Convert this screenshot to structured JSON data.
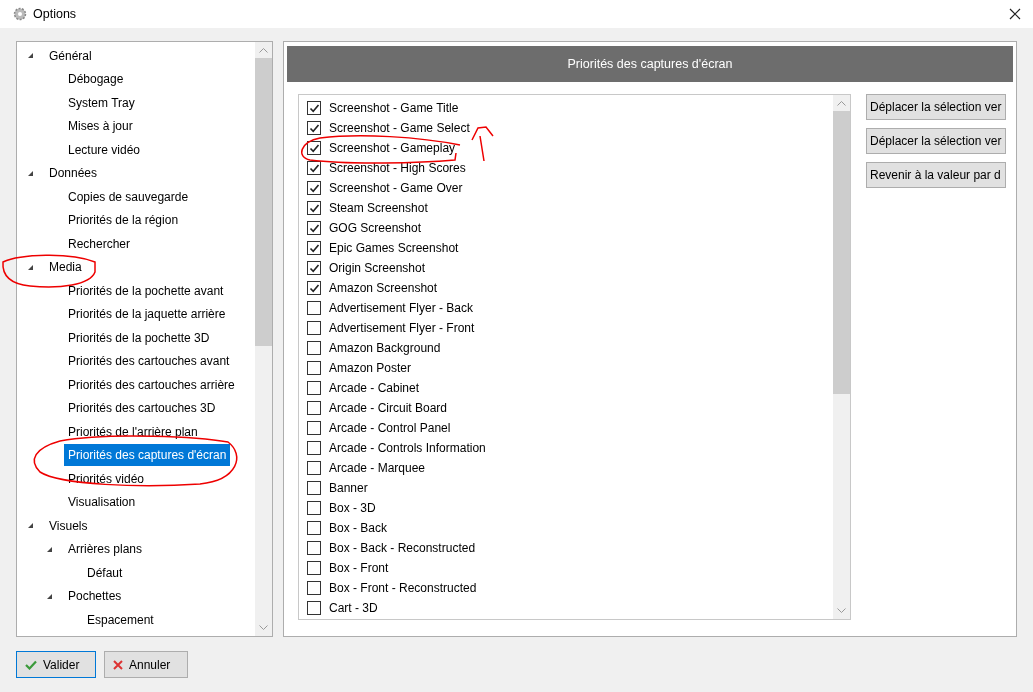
{
  "window": {
    "title": "Options"
  },
  "tree": [
    {
      "label": "Général",
      "expanded": true,
      "selected": false,
      "children": [
        {
          "label": "Débogage",
          "selected": false
        },
        {
          "label": "System Tray",
          "selected": false
        },
        {
          "label": "Mises à jour",
          "selected": false
        },
        {
          "label": "Lecture vidéo",
          "selected": false
        }
      ]
    },
    {
      "label": "Données",
      "expanded": true,
      "selected": false,
      "children": [
        {
          "label": "Copies de sauvegarde",
          "selected": false
        },
        {
          "label": "Priorités de la région",
          "selected": false
        },
        {
          "label": "Rechercher",
          "selected": false
        }
      ]
    },
    {
      "label": "Media",
      "expanded": true,
      "selected": false,
      "children": [
        {
          "label": "Priorités de la pochette avant",
          "selected": false
        },
        {
          "label": "Priorités de la jaquette arrière",
          "selected": false
        },
        {
          "label": "Priorités de la pochette 3D",
          "selected": false
        },
        {
          "label": "Priorités des cartouches avant",
          "selected": false
        },
        {
          "label": "Priorités des cartouches arrière",
          "selected": false
        },
        {
          "label": "Priorités des cartouches 3D",
          "selected": false
        },
        {
          "label": "Priorités de l'arrière plan",
          "selected": false
        },
        {
          "label": "Priorités des captures d'écran",
          "selected": true
        },
        {
          "label": "Priorités vidéo",
          "selected": false
        },
        {
          "label": "Visualisation",
          "selected": false
        }
      ]
    },
    {
      "label": "Visuels",
      "expanded": true,
      "selected": false,
      "children": [
        {
          "label": "Arrières plans",
          "expanded": true,
          "selected": false,
          "children": [
            {
              "label": "Défaut",
              "selected": false
            }
          ]
        },
        {
          "label": "Pochettes",
          "expanded": true,
          "selected": false,
          "children": [
            {
              "label": "Espacement",
              "selected": false
            }
          ]
        }
      ]
    }
  ],
  "panel": {
    "title": "Priorités des captures d'écran"
  },
  "items": [
    {
      "label": "Screenshot - Game Title",
      "checked": true
    },
    {
      "label": "Screenshot - Game Select",
      "checked": true
    },
    {
      "label": "Screenshot - Gameplay",
      "checked": true
    },
    {
      "label": "Screenshot - High Scores",
      "checked": true
    },
    {
      "label": "Screenshot - Game Over",
      "checked": true
    },
    {
      "label": "Steam Screenshot",
      "checked": true
    },
    {
      "label": "GOG Screenshot",
      "checked": true
    },
    {
      "label": "Epic Games Screenshot",
      "checked": true
    },
    {
      "label": "Origin Screenshot",
      "checked": true
    },
    {
      "label": "Amazon Screenshot",
      "checked": true
    },
    {
      "label": "Advertisement Flyer - Back",
      "checked": false
    },
    {
      "label": "Advertisement Flyer - Front",
      "checked": false
    },
    {
      "label": "Amazon Background",
      "checked": false
    },
    {
      "label": "Amazon Poster",
      "checked": false
    },
    {
      "label": "Arcade - Cabinet",
      "checked": false
    },
    {
      "label": "Arcade - Circuit Board",
      "checked": false
    },
    {
      "label": "Arcade - Control Panel",
      "checked": false
    },
    {
      "label": "Arcade - Controls Information",
      "checked": false
    },
    {
      "label": "Arcade - Marquee",
      "checked": false
    },
    {
      "label": "Banner",
      "checked": false
    },
    {
      "label": "Box - 3D",
      "checked": false
    },
    {
      "label": "Box - Back",
      "checked": false
    },
    {
      "label": "Box - Back - Reconstructed",
      "checked": false
    },
    {
      "label": "Box - Front",
      "checked": false
    },
    {
      "label": "Box - Front - Reconstructed",
      "checked": false
    },
    {
      "label": "Cart - 3D",
      "checked": false
    }
  ],
  "side_buttons": [
    "Déplacer la sélection ver",
    "Déplacer la sélection ver",
    "Revenir à la valeur par d"
  ],
  "footer": {
    "ok": "Valider",
    "cancel": "Annuler"
  }
}
